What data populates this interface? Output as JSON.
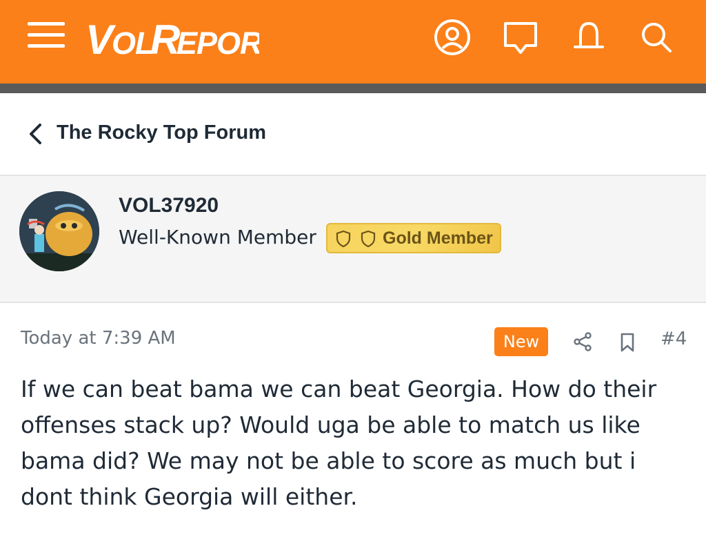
{
  "header": {
    "logo_text": "VolReport",
    "brand_color": "#fb8019",
    "icons": [
      "menu-icon",
      "account-icon",
      "chat-icon",
      "bell-icon",
      "search-icon"
    ]
  },
  "breadcrumb": {
    "label": "The Rocky Top Forum",
    "icon": "chevron-left-icon"
  },
  "member": {
    "username": "VOL37920",
    "title": "Well-Known Member",
    "badge": "Gold Member"
  },
  "post": {
    "time": "Today at 7:39 AM",
    "new_label": "New",
    "number": "#4",
    "body": "If we can beat bama we can beat Georgia. How do their offenses stack up? Would uga be able to match us like bama did? We may not be able to score as much but i dont think Georgia will either."
  }
}
